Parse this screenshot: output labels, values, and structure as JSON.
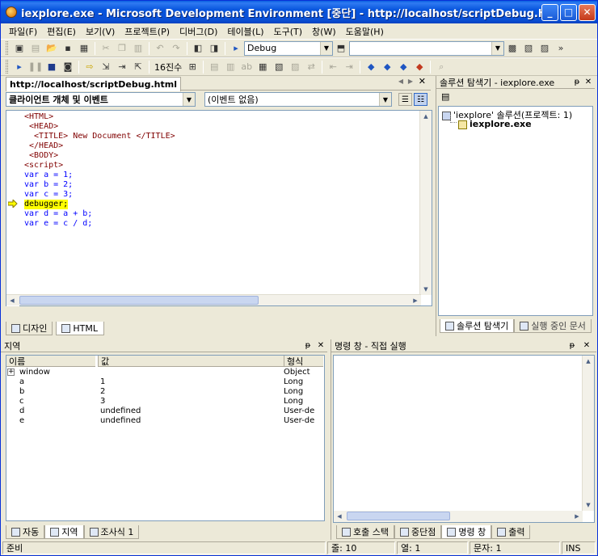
{
  "window": {
    "title": "iexplore.exe - Microsoft Development Environment [중단] - http://localhost/scriptDebug.html [읽기 전용]",
    "min_label": "_",
    "max_label": "□",
    "close_label": "✕"
  },
  "menu": [
    "파일(F)",
    "편집(E)",
    "보기(V)",
    "프로젝트(P)",
    "디버그(D)",
    "테이블(L)",
    "도구(T)",
    "창(W)",
    "도움말(H)"
  ],
  "toolbar1": {
    "config_value": "Debug",
    "find_value": ""
  },
  "toolbar2": {
    "hex_label": "16진수"
  },
  "editor": {
    "tab_label": "http://localhost/scriptDebug.html",
    "object_combo": "클라이언트 개체 및 이벤트",
    "event_combo": "(이벤트 없음)",
    "code_lines": [
      "<HTML>",
      " <HEAD>",
      "  <TITLE> New Document </TITLE>",
      " </HEAD>",
      " <BODY>",
      "<script>",
      "var a = 1;",
      "var b = 2;",
      "var c = 3;",
      "debugger;",
      "var d = a + b;",
      "var e = c / d;"
    ],
    "current_line_index": 9,
    "view_tabs": [
      "디자인",
      "HTML"
    ]
  },
  "solution_explorer": {
    "title": "솔루션 탐색기 - iexplore.exe",
    "pin": "ᵽ",
    "close": "✕",
    "solution_label": "'iexplore' 솔루션(프로젝트: 1)",
    "project_label": "iexplore.exe",
    "bottom_tabs": [
      "솔루션 탐색기",
      "실행 중인 문서"
    ]
  },
  "locals": {
    "title": "지역",
    "headers": [
      "이름",
      "값",
      "형식"
    ],
    "rows": [
      {
        "expand": "+",
        "name": "window",
        "value": "",
        "type": "Object"
      },
      {
        "expand": "",
        "name": "a",
        "value": "1",
        "type": "Long"
      },
      {
        "expand": "",
        "name": "b",
        "value": "2",
        "type": "Long"
      },
      {
        "expand": "",
        "name": "c",
        "value": "3",
        "type": "Long"
      },
      {
        "expand": "",
        "name": "d",
        "value": "undefined",
        "type": "User-de"
      },
      {
        "expand": "",
        "name": "e",
        "value": "undefined",
        "type": "User-de"
      }
    ],
    "bottom_tabs": [
      "자동",
      "지역",
      "조사식 1"
    ]
  },
  "command": {
    "title": "명령 창 - 직접 실행",
    "bottom_tabs": [
      "호출 스택",
      "중단점",
      "명령 창",
      "출력"
    ]
  },
  "statusbar": {
    "ready": "준비",
    "line": "줄: 10",
    "col": "열: 1",
    "chars": "문자: 1",
    "ins": "INS"
  }
}
